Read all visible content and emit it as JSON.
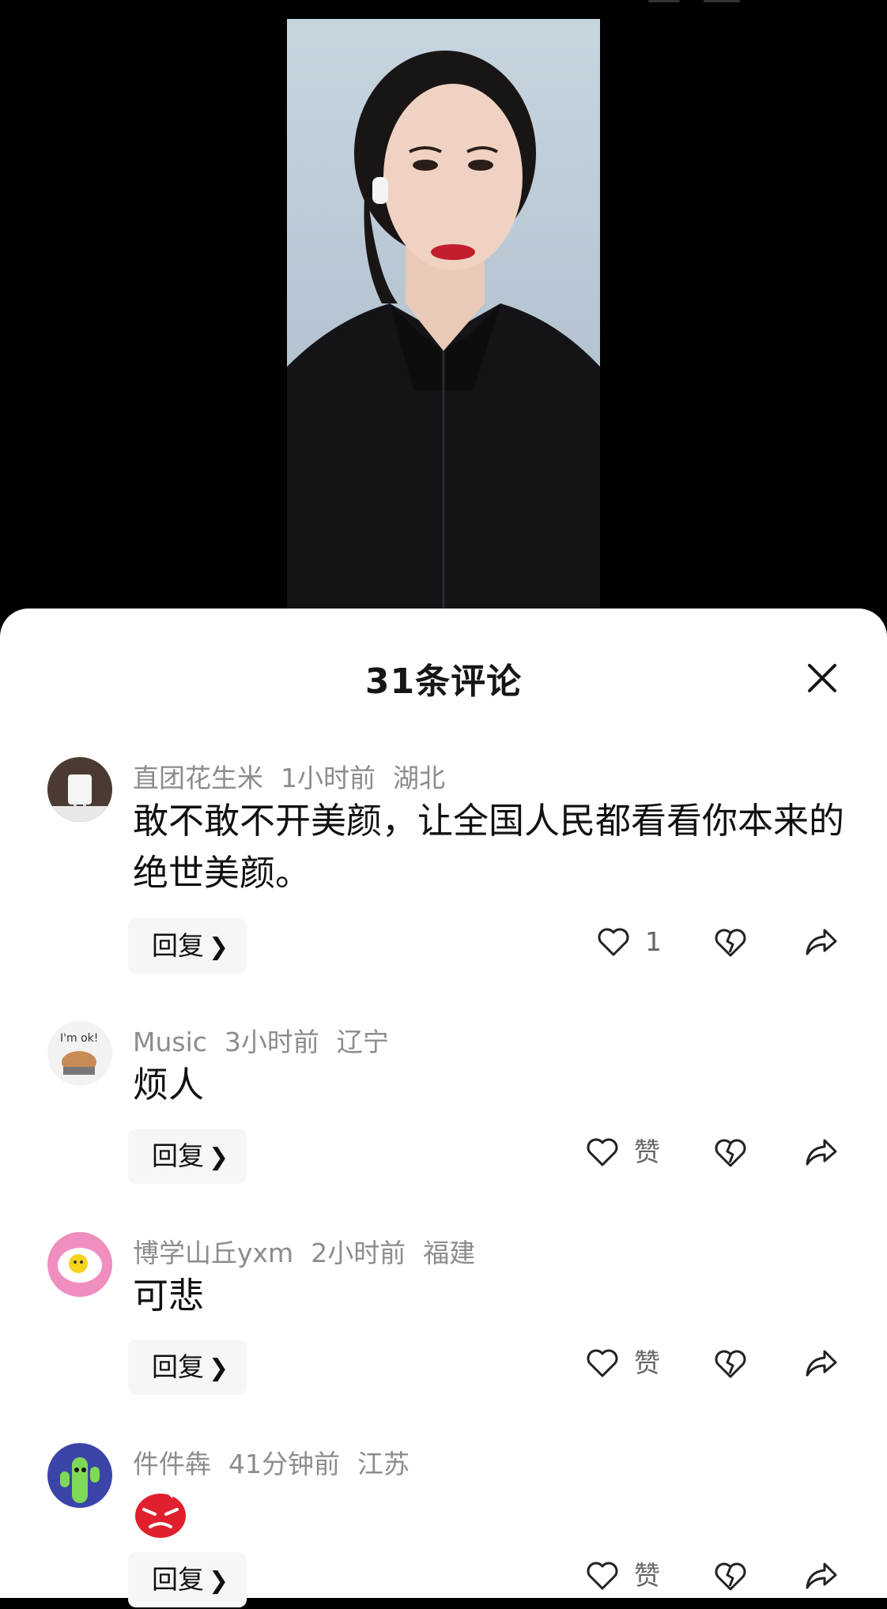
{
  "sheet": {
    "title": "31条评论"
  },
  "comments": [
    {
      "user": "直团花生米",
      "time": "1小时前",
      "location": "湖北",
      "text": "敢不敢不开美颜，让全国人民都看看你本来的绝世美颜。",
      "reply_label": "回复",
      "like_label": "1"
    },
    {
      "user": "Music",
      "time": "3小时前",
      "location": "辽宁",
      "text": "烦人",
      "reply_label": "回复",
      "like_label": "赞"
    },
    {
      "user": "博学山丘yxm",
      "time": "2小时前",
      "location": "福建",
      "text": "可悲",
      "reply_label": "回复",
      "like_label": "赞"
    },
    {
      "user": "件件犇",
      "time": "41分钟前",
      "location": "江苏",
      "text": "",
      "reply_label": "回复",
      "like_label": "赞"
    }
  ],
  "icons": {
    "close": "close-icon",
    "like": "heart-icon",
    "dislike": "broken-heart-icon",
    "share": "share-arrow-icon",
    "reply_chevron": "chevron-right-icon"
  },
  "colors": {
    "sheet_bg": "#ffffff",
    "meta_text": "#8c8c8c",
    "body_text": "#111111"
  }
}
